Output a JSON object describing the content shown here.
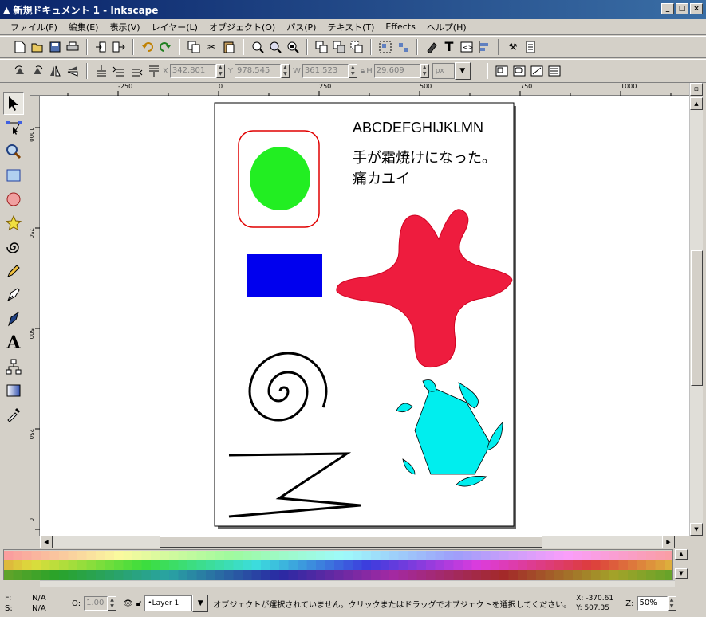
{
  "window": {
    "title": "新規ドキュメント 1 - Inkscape",
    "buttons": [
      "_",
      "□",
      "×"
    ]
  },
  "menu": [
    "ファイル(F)",
    "編集(E)",
    "表示(V)",
    "レイヤー(L)",
    "オブジェクト(O)",
    "パス(P)",
    "テキスト(T)",
    "Effects",
    "ヘルプ(H)"
  ],
  "toolbar1": {
    "icons": [
      "new-document-icon",
      "open-icon",
      "save-icon",
      "print-icon",
      "import-icon",
      "export-icon",
      "undo-icon",
      "redo-icon",
      "copy-icon",
      "cut-icon",
      "paste-icon",
      "zoom-selection-icon",
      "zoom-drawing-icon",
      "zoom-page-icon",
      "duplicate-icon",
      "clone-icon",
      "unlink-clone-icon",
      "group-icon",
      "ungroup-icon",
      "fill-stroke-icon",
      "text-font-icon",
      "xml-editor-icon",
      "align-icon",
      "preferences-icon",
      "document-properties-icon"
    ]
  },
  "toolbar2": {
    "x_label": "X",
    "x_value": "342.801",
    "y_label": "Y",
    "y_value": "978.545",
    "w_label": "W",
    "w_value": "361.523",
    "h_label": "H",
    "h_value": "29.609",
    "unit": "px"
  },
  "ruler": {
    "h_ticks": [
      "-250",
      "0",
      "250",
      "500",
      "750",
      "1000"
    ],
    "v_ticks": [
      "1000",
      "750",
      "500",
      "250",
      "0"
    ]
  },
  "drawing": {
    "text_latin": "ABCDEFGHIJKLMN",
    "text_jp1": "手が霜焼けになった。",
    "text_jp2": "痛カユイ",
    "colors": {
      "ellipse": "#22ee22",
      "rounded_rect_stroke": "#e00000",
      "rect": "#0000ee",
      "star": "#ee1c3e",
      "pentagon": "#00eeee"
    }
  },
  "status": {
    "f_label": "F:",
    "f_value": "N/A",
    "s_label": "S:",
    "s_value": "N/A",
    "opacity_label": "O:",
    "opacity_value": "1.00",
    "layer": "•Layer 1",
    "message": "オブジェクトが選択されていません。クリックまたはドラッグでオブジェクトを選択してください。",
    "coord_x": "X: -370.61",
    "coord_y": "Y: 507.35",
    "zoom_label": "Z:",
    "zoom": "50%"
  }
}
